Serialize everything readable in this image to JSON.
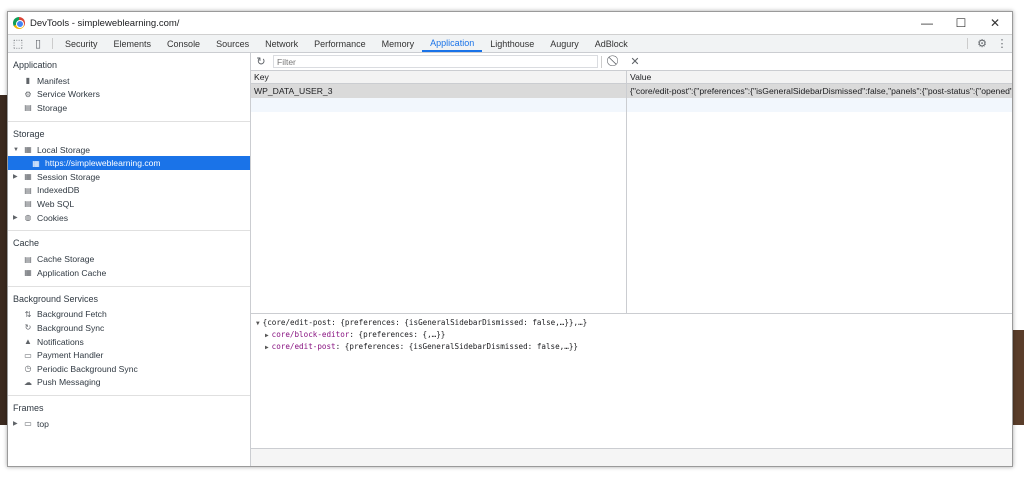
{
  "window": {
    "title": "DevTools - simpleweblearning.com/",
    "controls": [
      "—",
      "☐",
      "✕"
    ]
  },
  "tabs": [
    {
      "label": "Security"
    },
    {
      "label": "Elements"
    },
    {
      "label": "Console"
    },
    {
      "label": "Sources"
    },
    {
      "label": "Network"
    },
    {
      "label": "Performance"
    },
    {
      "label": "Memory"
    },
    {
      "label": "Application",
      "active": true
    },
    {
      "label": "Lighthouse"
    },
    {
      "label": "Augury"
    },
    {
      "label": "AdBlock"
    }
  ],
  "sidebar": {
    "application": {
      "title": "Application",
      "items": [
        "Manifest",
        "Service Workers",
        "Storage"
      ]
    },
    "storage": {
      "title": "Storage",
      "local_storage": "Local Storage",
      "local_storage_origin": "https://simpleweblearning.com",
      "session_storage": "Session Storage",
      "indexeddb": "IndexedDB",
      "websql": "Web SQL",
      "cookies": "Cookies"
    },
    "cache": {
      "title": "Cache",
      "items": [
        "Cache Storage",
        "Application Cache"
      ]
    },
    "background": {
      "title": "Background Services",
      "items": [
        "Background Fetch",
        "Background Sync",
        "Notifications",
        "Payment Handler",
        "Periodic Background Sync",
        "Push Messaging"
      ]
    },
    "frames": {
      "title": "Frames",
      "top": "top"
    }
  },
  "toolbar": {
    "filter_placeholder": "Filter"
  },
  "table": {
    "columns": {
      "key": "Key",
      "value": "Value"
    },
    "rows": [
      {
        "key": "WP_DATA_USER_3",
        "value": "{\"core/edit-post\":{\"preferences\":{\"isGeneralSidebarDismissed\":false,\"panels\":{\"post-status\":{\"opened\":t..."
      }
    ]
  },
  "preview": {
    "root": "{core/edit-post: {preferences: {isGeneralSidebarDismissed: false,…}},…}",
    "children": [
      {
        "key": "core/block-editor",
        "value": "{preferences: {,…}}"
      },
      {
        "key": "core/edit-post",
        "value": "{preferences: {isGeneralSidebarDismissed: false,…}}"
      }
    ]
  },
  "colors": {
    "accent": "#1a73e8",
    "selected_row": "#dadada"
  }
}
